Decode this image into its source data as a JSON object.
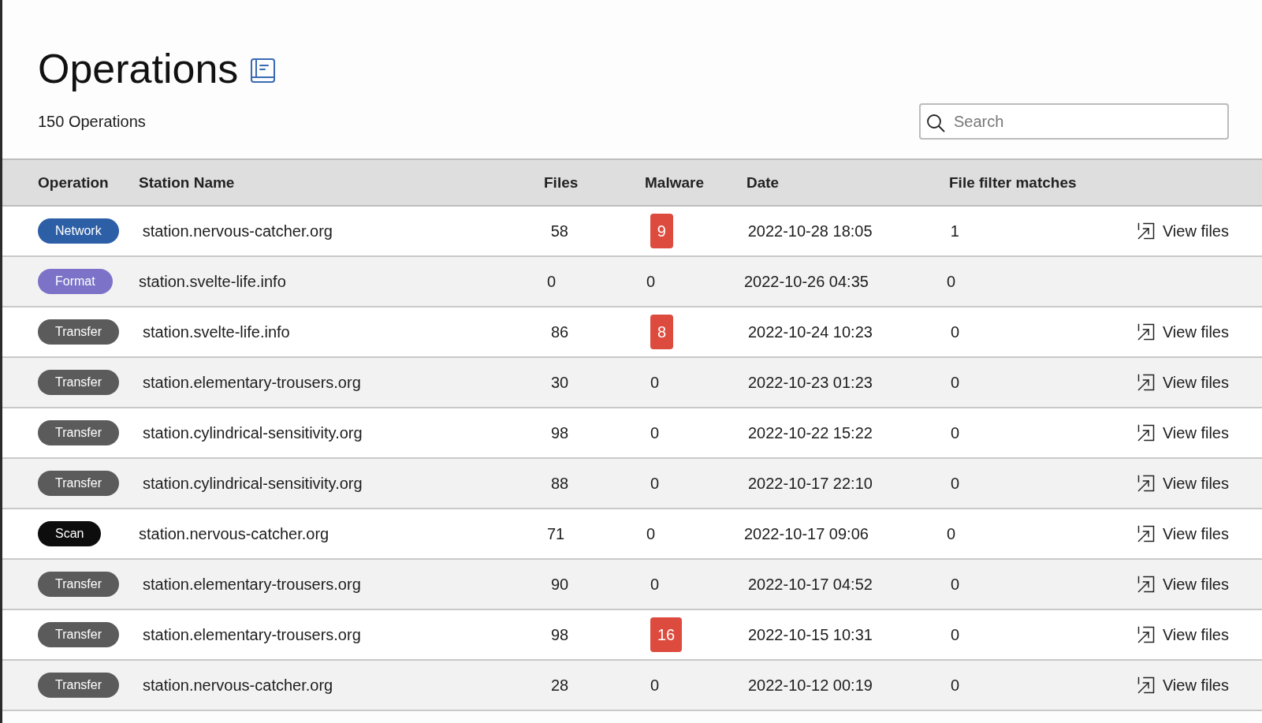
{
  "page": {
    "title": "Operations",
    "count": "150 Operations"
  },
  "search": {
    "placeholder": "Search"
  },
  "table": {
    "columns": [
      "Operation",
      "Station Name",
      "Files",
      "Malware",
      "Date",
      "File filter matches"
    ],
    "rows": [
      {
        "operation": {
          "label": "Network",
          "color": "#2d5fa6"
        },
        "station": "station.nervous-catcher.org",
        "files": "58",
        "malware": {
          "value": "9",
          "alert": true
        },
        "date": "2022-10-28 18:05",
        "filter_matches": "1",
        "link": "View files"
      },
      {
        "operation": {
          "label": "Format",
          "color": "#7c73c8"
        },
        "station": "station.svelte-life.info",
        "files": "0",
        "malware": {
          "value": "0",
          "alert": false
        },
        "date": "2022-10-26 04:35",
        "filter_matches": "0"
      },
      {
        "operation": {
          "label": "Transfer",
          "color": "#5b5b5b"
        },
        "station": "station.svelte-life.info",
        "files": "86",
        "malware": {
          "value": "8",
          "alert": true
        },
        "date": "2022-10-24 10:23",
        "filter_matches": "0",
        "link": "View files"
      },
      {
        "operation": {
          "label": "Transfer",
          "color": "#5b5b5b"
        },
        "station": "station.elementary-trousers.org",
        "files": "30",
        "malware": {
          "value": "0",
          "alert": false
        },
        "date": "2022-10-23 01:23",
        "filter_matches": "0",
        "link": "View files"
      },
      {
        "operation": {
          "label": "Transfer",
          "color": "#5b5b5b"
        },
        "station": "station.cylindrical-sensitivity.org",
        "files": "98",
        "malware": {
          "value": "0",
          "alert": false
        },
        "date": "2022-10-22 15:22",
        "filter_matches": "0",
        "link": "View files"
      },
      {
        "operation": {
          "label": "Transfer",
          "color": "#5b5b5b"
        },
        "station": "station.cylindrical-sensitivity.org",
        "files": "88",
        "malware": {
          "value": "0",
          "alert": false
        },
        "date": "2022-10-17 22:10",
        "filter_matches": "0",
        "link": "View files"
      },
      {
        "operation": {
          "label": "Scan",
          "color": "#0d0d0d"
        },
        "station": "station.nervous-catcher.org",
        "files": "71",
        "malware": {
          "value": "0",
          "alert": false
        },
        "date": "2022-10-17 09:06",
        "filter_matches": "0",
        "link": "View files"
      },
      {
        "operation": {
          "label": "Transfer",
          "color": "#5b5b5b"
        },
        "station": "station.elementary-trousers.org",
        "files": "90",
        "malware": {
          "value": "0",
          "alert": false
        },
        "date": "2022-10-17 04:52",
        "filter_matches": "0",
        "link": "View files"
      },
      {
        "operation": {
          "label": "Transfer",
          "color": "#5b5b5b"
        },
        "station": "station.elementary-trousers.org",
        "files": "98",
        "malware": {
          "value": "16",
          "alert": true
        },
        "date": "2022-10-15 10:31",
        "filter_matches": "0",
        "link": "View files"
      },
      {
        "operation": {
          "label": "Transfer",
          "color": "#5b5b5b"
        },
        "station": "station.nervous-catcher.org",
        "files": "28",
        "malware": {
          "value": "0",
          "alert": false
        },
        "date": "2022-10-12 00:19",
        "filter_matches": "0",
        "link": "View files"
      }
    ]
  }
}
